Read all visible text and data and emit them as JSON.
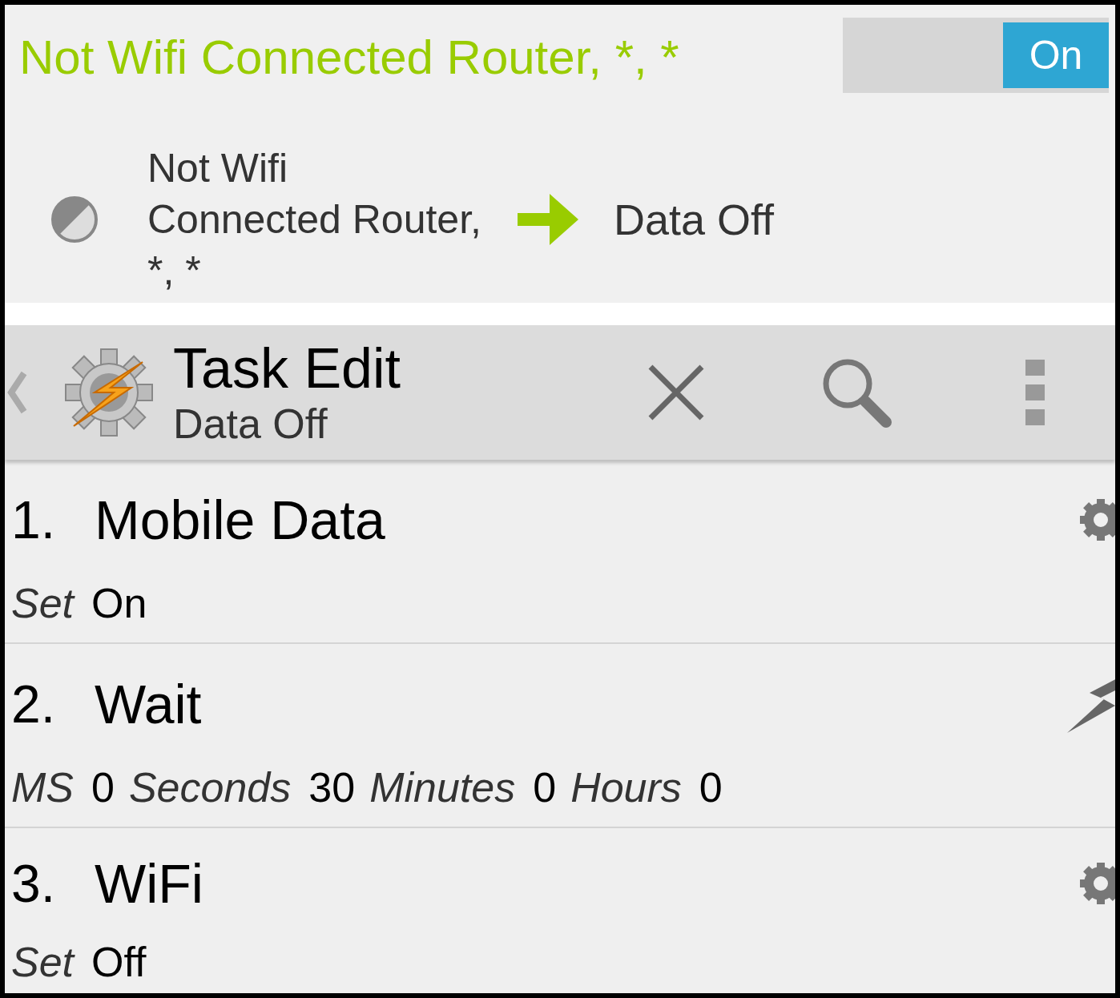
{
  "profile": {
    "title": "Not Wifi Connected Router, *, *",
    "toggle": {
      "label": "On",
      "on": true
    },
    "context_lines": [
      "Not Wifi",
      "Connected Router,",
      "*, *"
    ],
    "task": "Data Off"
  },
  "action_bar": {
    "title": "Task Edit",
    "subtitle": "Data Off"
  },
  "actions": [
    {
      "number": "1.",
      "name": "Mobile Data",
      "kind": "gear",
      "params": [
        {
          "label": "Set",
          "value": "On"
        }
      ]
    },
    {
      "number": "2.",
      "name": "Wait",
      "kind": "bolt",
      "params": [
        {
          "label": "MS",
          "value": "0"
        },
        {
          "label": "Seconds",
          "value": "30"
        },
        {
          "label": "Minutes",
          "value": "0"
        },
        {
          "label": "Hours",
          "value": "0"
        }
      ]
    },
    {
      "number": "3.",
      "name": "WiFi",
      "kind": "gear",
      "params": [
        {
          "label": "Set",
          "value": "Off"
        }
      ]
    }
  ]
}
